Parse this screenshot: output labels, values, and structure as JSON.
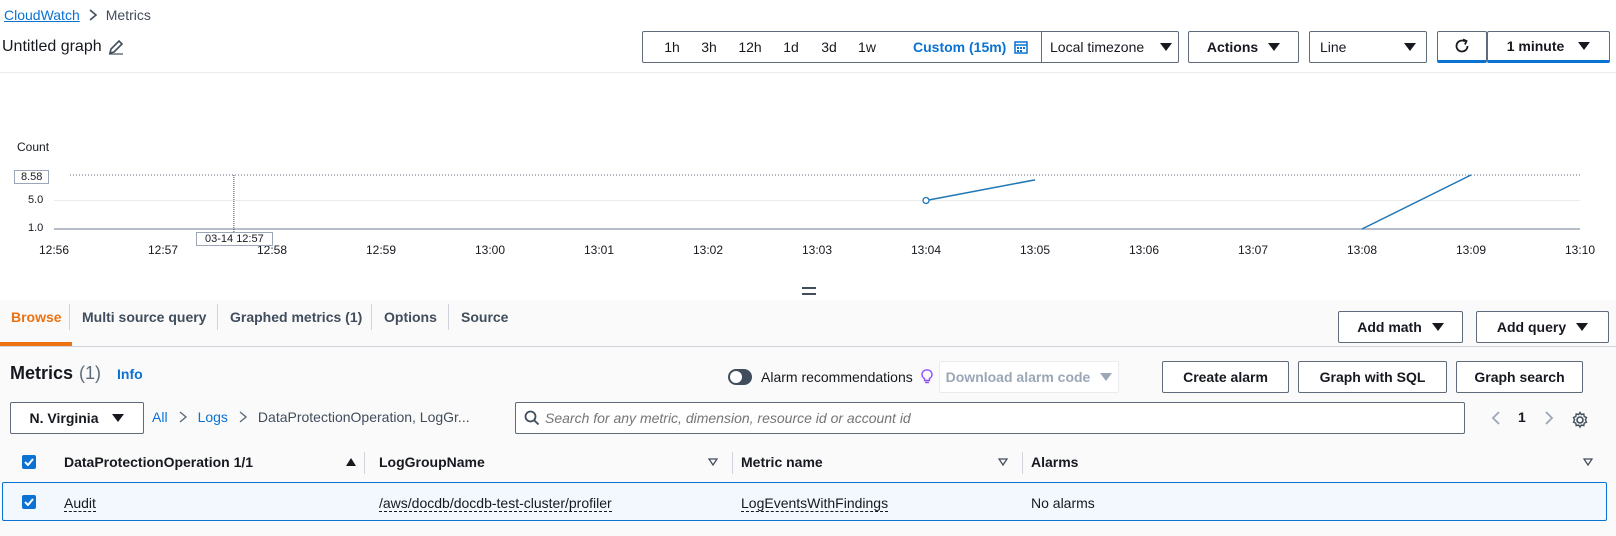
{
  "breadcrumb": {
    "root": "CloudWatch",
    "current": "Metrics"
  },
  "graph_title": "Untitled graph",
  "time_ranges": [
    "1h",
    "3h",
    "12h",
    "1d",
    "3d",
    "1w"
  ],
  "custom_range": "Custom (15m)",
  "timezone": "Local timezone",
  "actions_label": "Actions",
  "chart_type_label": "Line",
  "refresh_interval": "1 minute",
  "chart_data": {
    "type": "line",
    "ylabel": "Count",
    "y_ticks": [
      "1.0",
      "5.0"
    ],
    "y_max_label": "8.58",
    "ylim": [
      1.0,
      8.58
    ],
    "x_ticks": [
      "12:56",
      "12:57",
      "12:58",
      "12:59",
      "13:00",
      "13:01",
      "13:02",
      "13:03",
      "13:04",
      "13:05",
      "13:06",
      "13:07",
      "13:08",
      "13:09",
      "13:10"
    ],
    "crosshair_label": "03-14 12:57",
    "series": [
      {
        "color": "#1f77b4",
        "segments": [
          [
            [
              "13:04",
              5.0
            ],
            [
              "13:05",
              7.9
            ]
          ],
          [
            [
              "13:08",
              1.0
            ],
            [
              "13:09",
              8.58
            ]
          ]
        ]
      }
    ]
  },
  "tabs": {
    "browse": "Browse",
    "multi_source": "Multi source query",
    "graphed": "Graphed metrics (1)",
    "options": "Options",
    "source": "Source"
  },
  "add_math": "Add math",
  "add_query": "Add query",
  "metrics_section": {
    "title": "Metrics",
    "count": "(1)",
    "info": "Info"
  },
  "alarm_recommendations": "Alarm recommendations",
  "download_alarm_code": "Download alarm code",
  "create_alarm": "Create alarm",
  "graph_with_sql": "Graph with SQL",
  "graph_search": "Graph search",
  "region": "N. Virginia",
  "filter_breadcrumb": {
    "all": "All",
    "logs": "Logs",
    "current": "DataProtectionOperation, LogGr..."
  },
  "search": {
    "placeholder": "Search for any metric, dimension, resource id or account id",
    "value": ""
  },
  "pagination": {
    "page": "1"
  },
  "table": {
    "columns": [
      "DataProtectionOperation 1/1",
      "LogGroupName",
      "Metric name",
      "Alarms"
    ],
    "rows": [
      [
        "Audit",
        "/aws/docdb/docdb-test-cluster/profiler",
        "LogEventsWithFindings",
        "No alarms"
      ]
    ]
  },
  "colors": {
    "accent": "#0972d3",
    "active_tab": "#ec7211",
    "line": "#1f77b4"
  }
}
